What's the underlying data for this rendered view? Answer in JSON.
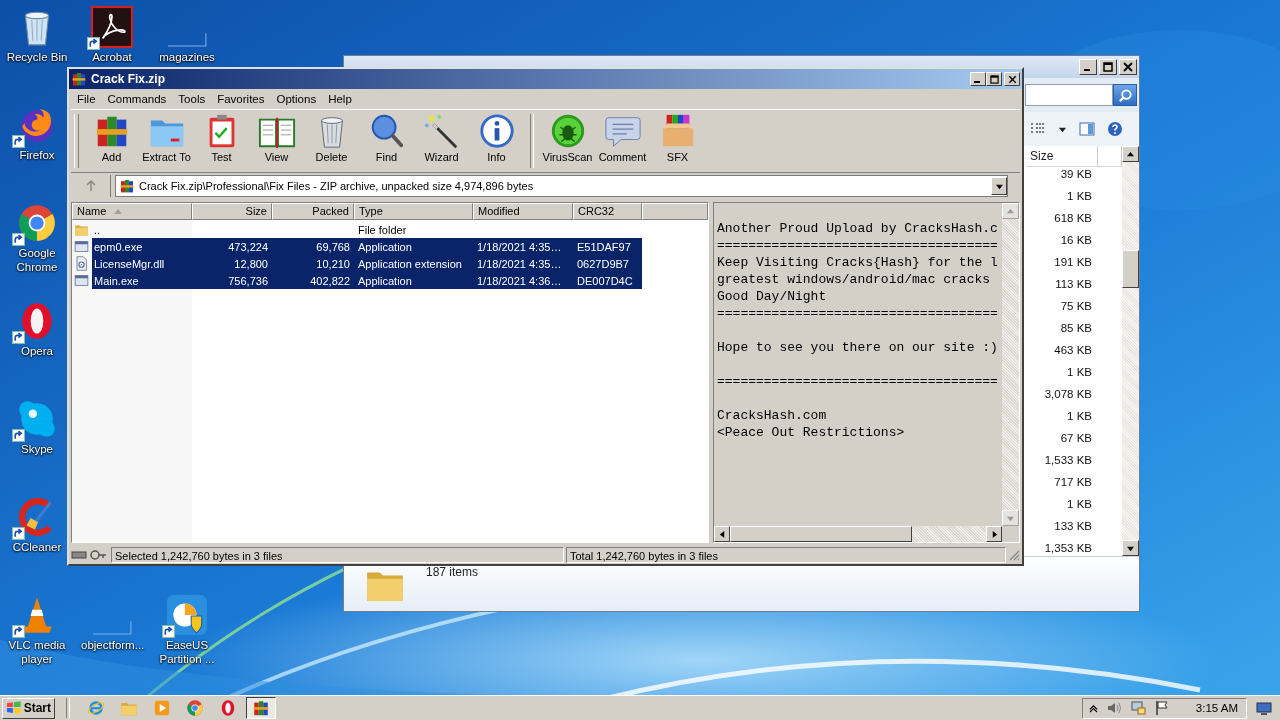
{
  "desktop_icons": [
    {
      "label": "Recycle Bin",
      "kind": "recycle",
      "shortcut": false
    },
    {
      "label": "Acrobat",
      "kind": "acrobat",
      "shortcut": true
    },
    {
      "label": "magazines",
      "kind": "blank",
      "shortcut": false
    },
    {
      "label": "Firefox",
      "kind": "firefox",
      "shortcut": true
    },
    {
      "label": "Google Chrome",
      "kind": "chrome",
      "shortcut": true
    },
    {
      "label": "Opera",
      "kind": "opera",
      "shortcut": true
    },
    {
      "label": "Skype",
      "kind": "skype",
      "shortcut": true
    },
    {
      "label": "CCleaner",
      "kind": "ccleaner",
      "shortcut": true
    },
    {
      "label": "VLC media player",
      "kind": "vlc",
      "shortcut": true
    },
    {
      "label": "objectform...",
      "kind": "blank",
      "shortcut": false
    },
    {
      "label": "EaseUS Partition ...",
      "kind": "easeus",
      "shortcut": true
    }
  ],
  "explorer_window": {
    "column": "Size",
    "sizes": [
      "39 KB",
      "1 KB",
      "618 KB",
      "16 KB",
      "191 KB",
      "113 KB",
      "75 KB",
      "85 KB",
      "463 KB",
      "1 KB",
      "3,078 KB",
      "1 KB",
      "67 KB",
      "1,533 KB",
      "717 KB",
      "1 KB",
      "133 KB",
      "1,353 KB"
    ],
    "details": "187 items"
  },
  "archive_window": {
    "title": "Crack Fix.zip",
    "menu": [
      "File",
      "Commands",
      "Tools",
      "Favorites",
      "Options",
      "Help"
    ],
    "toolbar_groups": [
      {
        "buttons": [
          {
            "label": "Add",
            "kind": "add"
          },
          {
            "label": "Extract To",
            "kind": "extract"
          },
          {
            "label": "Test",
            "kind": "test"
          },
          {
            "label": "View",
            "kind": "view"
          },
          {
            "label": "Delete",
            "kind": "delete"
          },
          {
            "label": "Find",
            "kind": "find"
          },
          {
            "label": "Wizard",
            "kind": "wizard"
          },
          {
            "label": "Info",
            "kind": "info"
          }
        ]
      },
      {
        "buttons": [
          {
            "label": "VirusScan",
            "kind": "virus"
          },
          {
            "label": "Comment",
            "kind": "comment"
          },
          {
            "label": "SFX",
            "kind": "sfx"
          }
        ]
      }
    ],
    "path": "Crack Fix.zip\\Professional\\Fix Files - ZIP archive, unpacked size 4,974,896 bytes",
    "columns": [
      {
        "label": "Name",
        "sorted": true
      },
      {
        "label": "Size",
        "sorted": false
      },
      {
        "label": "Packed",
        "sorted": false
      },
      {
        "label": "Type",
        "sorted": false
      },
      {
        "label": "Modified",
        "sorted": false
      },
      {
        "label": "CRC32",
        "sorted": false
      }
    ],
    "rows": [
      {
        "kind": "folder",
        "name": "..",
        "type": "File folder",
        "selected": false
      },
      {
        "kind": "exe",
        "name": "epm0.exe",
        "size": "473,224",
        "packed": "69,768",
        "type": "Application",
        "modified": "1/18/2021 4:35…",
        "crc32": "E51DAF97",
        "selected": true
      },
      {
        "kind": "dll",
        "name": "LicenseMgr.dll",
        "size": "12,800",
        "packed": "10,210",
        "type": "Application extension",
        "modified": "1/18/2021 4:35…",
        "crc32": "0627D9B7",
        "selected": true
      },
      {
        "kind": "exe",
        "name": "Main.exe",
        "size": "756,736",
        "packed": "402,822",
        "type": "Application",
        "modified": "1/18/2021 4:36…",
        "crc32": "DE007D4C",
        "selected": true
      }
    ],
    "comment_paragraphs": [
      [
        "Another Proud Upload by CracksHash.c",
        "====================================",
        "Keep Visiting Cracks{Hash} for the l",
        "greatest windows/android/mac cracks",
        "Good Day/Night",
        "===================================="
      ],
      [
        "Hope to see you there on our site :)"
      ],
      [
        "===================================="
      ],
      [
        "CracksHash.com",
        "<Peace Out Restrictions>"
      ]
    ],
    "status": [
      "Selected 1,242,760 bytes in 3 files",
      "Total 1,242,760 bytes in 3 files"
    ]
  },
  "taskbar": {
    "start": "Start",
    "items": [
      {
        "kind": "ie",
        "active": false
      },
      {
        "kind": "explorer",
        "active": false
      },
      {
        "kind": "media",
        "active": false
      },
      {
        "kind": "chrome",
        "active": false
      },
      {
        "kind": "opera",
        "active": false
      },
      {
        "kind": "winrar",
        "active": true
      }
    ],
    "clock": "3:15 AM"
  }
}
